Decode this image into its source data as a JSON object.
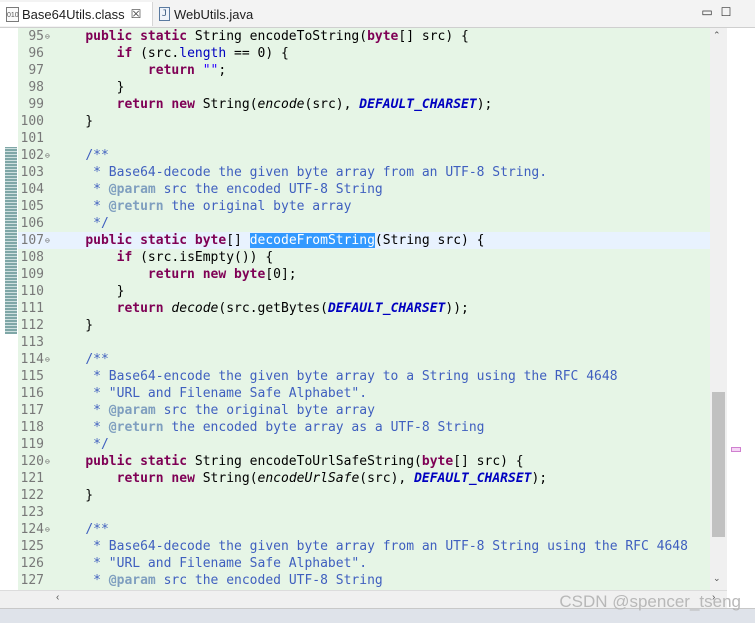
{
  "tabs": [
    {
      "label": "Base64Utils.class",
      "icon": "class-file-icon",
      "close": "☒"
    },
    {
      "label": "WebUtils.java",
      "icon": "java-file-icon"
    }
  ],
  "window_controls": {
    "minimize": "▭",
    "maximize": "☐"
  },
  "watermark": "CSDN @spencer_tseng",
  "lines": [
    {
      "n": "95",
      "fold": "⊖",
      "html": "    <span class='k'>public static</span> String encodeToString(<span class='k'>byte</span>[] src) {"
    },
    {
      "n": "96",
      "html": "        <span class='k'>if</span> (src.<span class='f'>length</span> == 0) {"
    },
    {
      "n": "97",
      "html": "            <span class='k'>return</span> <span class='s'>\"\"</span>;"
    },
    {
      "n": "98",
      "html": "        }"
    },
    {
      "n": "99",
      "html": "        <span class='k'>return new</span> String(<span class='i'>encode</span>(src), <span class='sf'>DEFAULT_CHARSET</span>);"
    },
    {
      "n": "100",
      "html": "    }"
    },
    {
      "n": "101",
      "html": ""
    },
    {
      "n": "102",
      "fold": "⊖",
      "html": "    <span class='c'>/**</span>"
    },
    {
      "n": "103",
      "html": "<span class='c'>     * Base64-decode the given byte array from an UTF-8 String.</span>"
    },
    {
      "n": "104",
      "html": "<span class='c'>     * </span><span class='ct'>@param</span><span class='c'> src the encoded UTF-8 String</span>"
    },
    {
      "n": "105",
      "html": "<span class='c'>     * </span><span class='ct'>@return</span><span class='c'> the original byte array</span>"
    },
    {
      "n": "106",
      "html": "<span class='c'>     */</span>"
    },
    {
      "n": "107",
      "fold": "⊖",
      "current": true,
      "html": "    <span class='k'>public static byte</span>[] <span class='sel'>decodeFromString</span>(String src) {"
    },
    {
      "n": "108",
      "html": "        <span class='k'>if</span> (src.isEmpty()) {"
    },
    {
      "n": "109",
      "html": "            <span class='k'>return new byte</span>[0];"
    },
    {
      "n": "110",
      "html": "        }"
    },
    {
      "n": "111",
      "html": "        <span class='k'>return</span> <span class='i'>decode</span>(src.getBytes(<span class='sf'>DEFAULT_CHARSET</span>));"
    },
    {
      "n": "112",
      "html": "    }"
    },
    {
      "n": "113",
      "html": ""
    },
    {
      "n": "114",
      "fold": "⊖",
      "html": "    <span class='c'>/**</span>"
    },
    {
      "n": "115",
      "html": "<span class='c'>     * Base64-encode the given byte array to a String using the RFC 4648</span>"
    },
    {
      "n": "116",
      "html": "<span class='c'>     * \"URL and Filename Safe Alphabet\".</span>"
    },
    {
      "n": "117",
      "html": "<span class='c'>     * </span><span class='ct'>@param</span><span class='c'> src the original byte array</span>"
    },
    {
      "n": "118",
      "html": "<span class='c'>     * </span><span class='ct'>@return</span><span class='c'> the encoded byte array as a UTF-8 String</span>"
    },
    {
      "n": "119",
      "html": "<span class='c'>     */</span>"
    },
    {
      "n": "120",
      "fold": "⊖",
      "html": "    <span class='k'>public static</span> String encodeToUrlSafeString(<span class='k'>byte</span>[] src) {"
    },
    {
      "n": "121",
      "html": "        <span class='k'>return new</span> String(<span class='i'>encodeUrlSafe</span>(src), <span class='sf'>DEFAULT_CHARSET</span>);"
    },
    {
      "n": "122",
      "html": "    }"
    },
    {
      "n": "123",
      "html": ""
    },
    {
      "n": "124",
      "fold": "⊖",
      "html": "    <span class='c'>/**</span>"
    },
    {
      "n": "125",
      "html": "<span class='c'>     * Base64-decode the given byte array from an UTF-8 String using the RFC 4648</span>"
    },
    {
      "n": "126",
      "html": "<span class='c'>     * \"URL and Filename Safe Alphabet\".</span>"
    },
    {
      "n": "127",
      "html": "<span class='c'>     * </span><span class='ct'>@param</span><span class='c'> src the encoded UTF-8 String</span>"
    }
  ]
}
